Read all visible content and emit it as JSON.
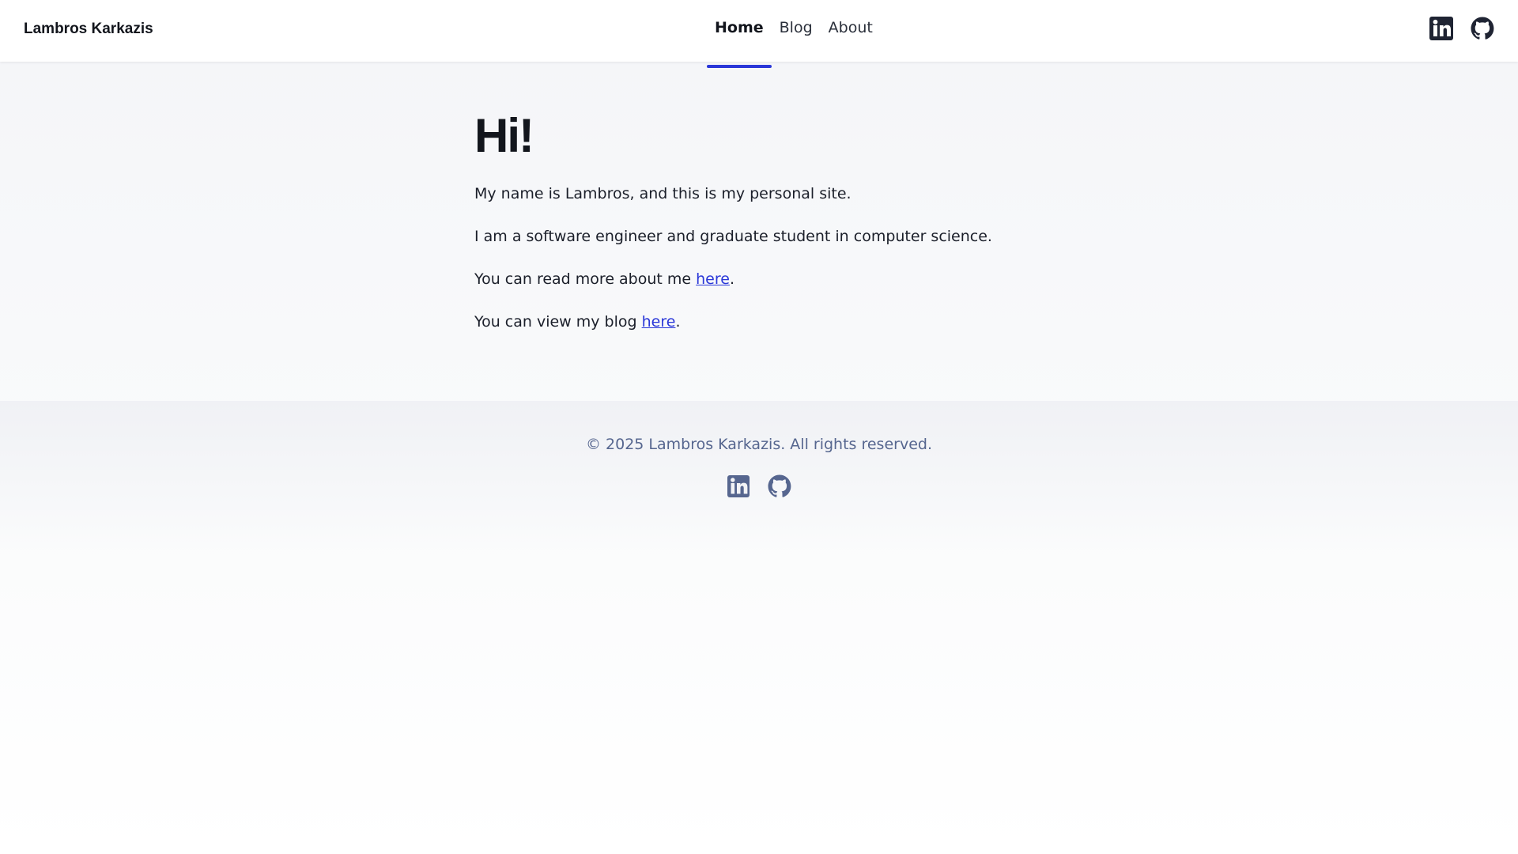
{
  "header": {
    "brand": "Lambros Karkazis",
    "nav": [
      {
        "label": "Home",
        "active": true
      },
      {
        "label": "Blog",
        "active": false
      },
      {
        "label": "About",
        "active": false
      }
    ],
    "social": [
      "linkedin-icon",
      "github-icon"
    ]
  },
  "main": {
    "heading": "Hi!",
    "p1": "My name is Lambros, and this is my personal site.",
    "p2": "I am a software engineer and graduate student in computer science.",
    "p3_prefix": "You can read more about me ",
    "p3_link": "here",
    "p3_suffix": ".",
    "p4_prefix": "You can view my blog ",
    "p4_link": "here",
    "p4_suffix": "."
  },
  "footer": {
    "copyright": "© 2025 Lambros Karkazis. All rights reserved.",
    "social": [
      "linkedin-icon",
      "github-icon"
    ]
  },
  "colors": {
    "accent": "#2a37d8",
    "text": "#12151c",
    "footer_text": "#56668f"
  }
}
